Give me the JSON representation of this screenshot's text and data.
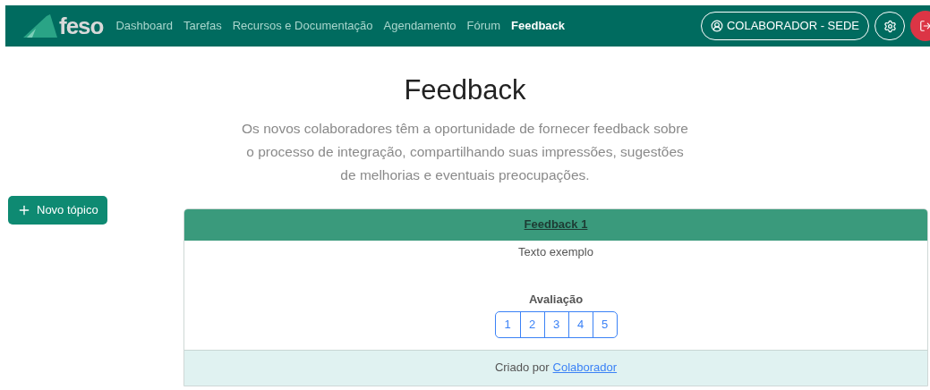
{
  "navbar": {
    "logo": "feso",
    "links": [
      {
        "label": "Dashboard",
        "selected": false
      },
      {
        "label": "Tarefas",
        "selected": false
      },
      {
        "label": "Recursos e Documentação",
        "selected": false
      },
      {
        "label": "Agendamento",
        "selected": false
      },
      {
        "label": "Fórum",
        "selected": false
      },
      {
        "label": "Feedback",
        "selected": true
      }
    ],
    "user": "COLABORADOR - SEDE"
  },
  "page": {
    "title": "Feedback",
    "description": "Os novos colaboradores têm a oportunidade de fornecer feedback sobre o processo de integração, compartilhando suas impressões, sugestões de melhorias e eventuais preocupações."
  },
  "new_topic_button": "Novo tópico",
  "topic": {
    "title": "Feedback 1",
    "body": "Texto exemplo",
    "rating_label": "Avaliação",
    "rating_options": [
      "1",
      "2",
      "3",
      "4",
      "5"
    ],
    "footer_prefix": "Criado por",
    "author": "Colaborador"
  }
}
